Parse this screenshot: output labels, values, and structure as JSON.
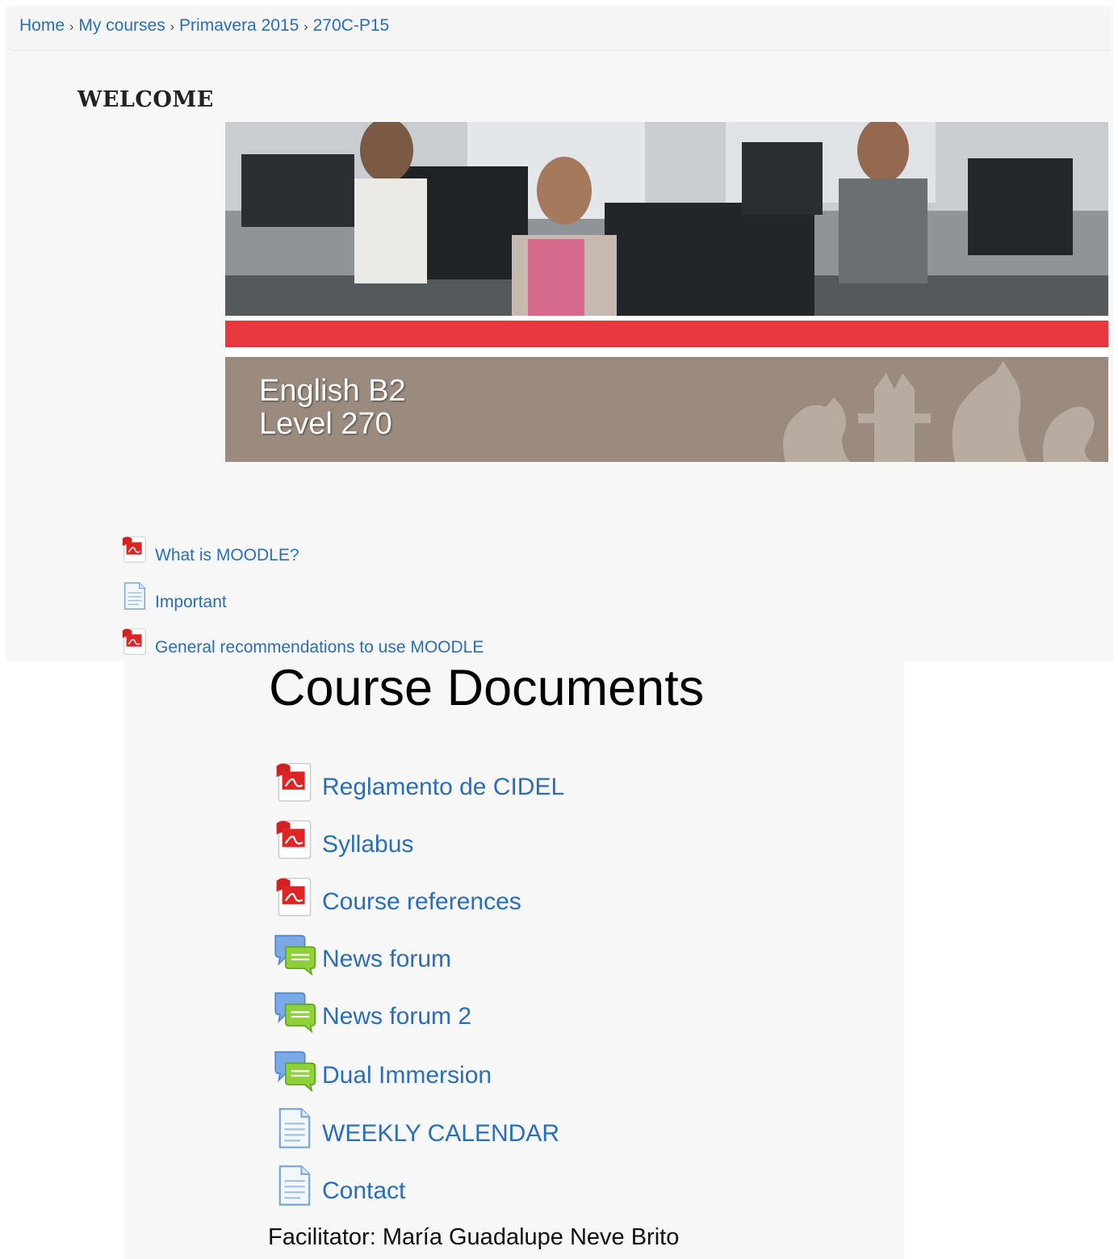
{
  "breadcrumb": {
    "items": [
      "Home",
      "My courses",
      "Primavera 2015",
      "270C-P15"
    ],
    "separator": "›"
  },
  "welcome": {
    "heading": "WELCOME"
  },
  "banner": {
    "line1": "English B2",
    "line2": "Level 270"
  },
  "intro_resources": [
    {
      "label": "What is MOODLE?",
      "icon": "pdf-icon"
    },
    {
      "label": "Important",
      "icon": "page-icon"
    },
    {
      "label": "General recommendations to use MOODLE",
      "icon": "pdf-icon"
    }
  ],
  "course_documents": {
    "title": "Course Documents",
    "items": [
      {
        "label": "Reglamento de CIDEL",
        "icon": "pdf-icon"
      },
      {
        "label": "Syllabus",
        "icon": "pdf-icon"
      },
      {
        "label": "Course references",
        "icon": "pdf-icon"
      },
      {
        "label": "News forum",
        "icon": "forum-icon"
      },
      {
        "label": "News forum 2",
        "icon": "forum-icon"
      },
      {
        "label": "Dual Immersion",
        "icon": "forum-icon"
      },
      {
        "label": "WEEKLY CALENDAR",
        "icon": "page-icon"
      },
      {
        "label": "Contact",
        "icon": "page-icon"
      }
    ],
    "facilitator": "Facilitator: María Guadalupe Neve Brito"
  },
  "colors": {
    "link": "#2a6ebb",
    "banner_red": "#e8383f",
    "banner_brown": "#9a8b7e"
  }
}
